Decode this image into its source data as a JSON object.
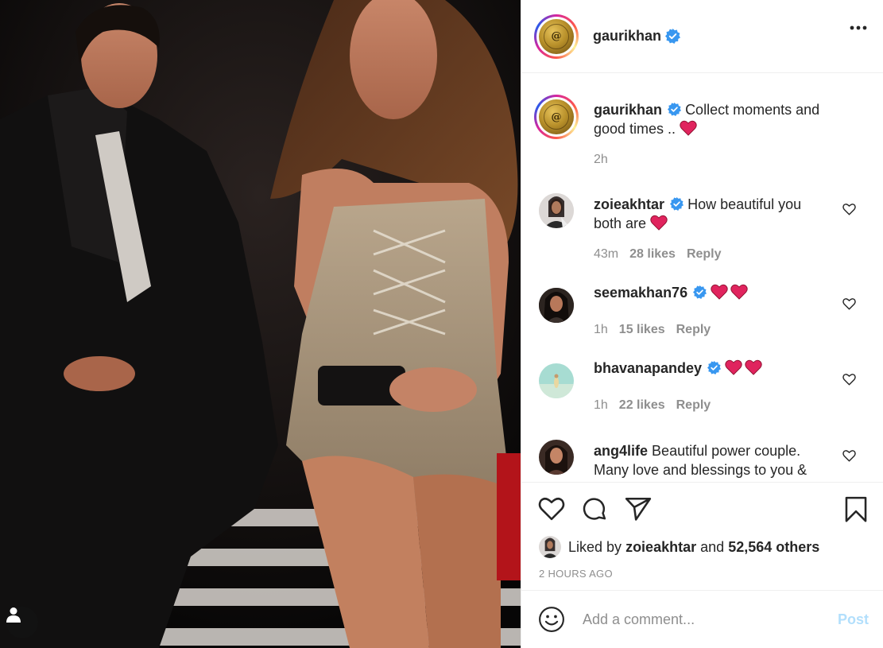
{
  "post": {
    "username": "gaurikhan",
    "avatar_text": "@",
    "caption": "Collect moments and good times ..",
    "caption_time": "2h"
  },
  "comments": [
    {
      "username": "zoieakhtar",
      "text": "How beautiful you both are",
      "time": "43m",
      "likes": "28 likes",
      "reply": "Reply",
      "hearts": 1
    },
    {
      "username": "seemakhan76",
      "text": "",
      "time": "1h",
      "likes": "15 likes",
      "reply": "Reply",
      "hearts": 2
    },
    {
      "username": "bhavanapandey",
      "text": "",
      "time": "1h",
      "likes": "22 likes",
      "reply": "Reply",
      "hearts": 2
    },
    {
      "username": "ang4life",
      "text": "Beautiful power couple. Many love and blessings to you &",
      "time": "",
      "likes": "",
      "reply": "",
      "hearts": 0
    }
  ],
  "likes_summary": {
    "prefix": "Liked by",
    "user": "zoieakhtar",
    "joiner": "and",
    "others": "52,564 others"
  },
  "timestamp": "2 HOURS AGO",
  "add_comment": {
    "placeholder": "Add a comment...",
    "post_label": "Post"
  },
  "colors": {
    "verified": "#3897f0",
    "heart_emoji": "#e0245e",
    "post_disabled": "#b2dffc",
    "muted": "#8e8e8e"
  },
  "icons": [
    "more-icon",
    "verified-icon",
    "heart-icon",
    "comment-icon",
    "share-icon",
    "bookmark-icon",
    "emoji-icon",
    "user-tag-icon"
  ]
}
